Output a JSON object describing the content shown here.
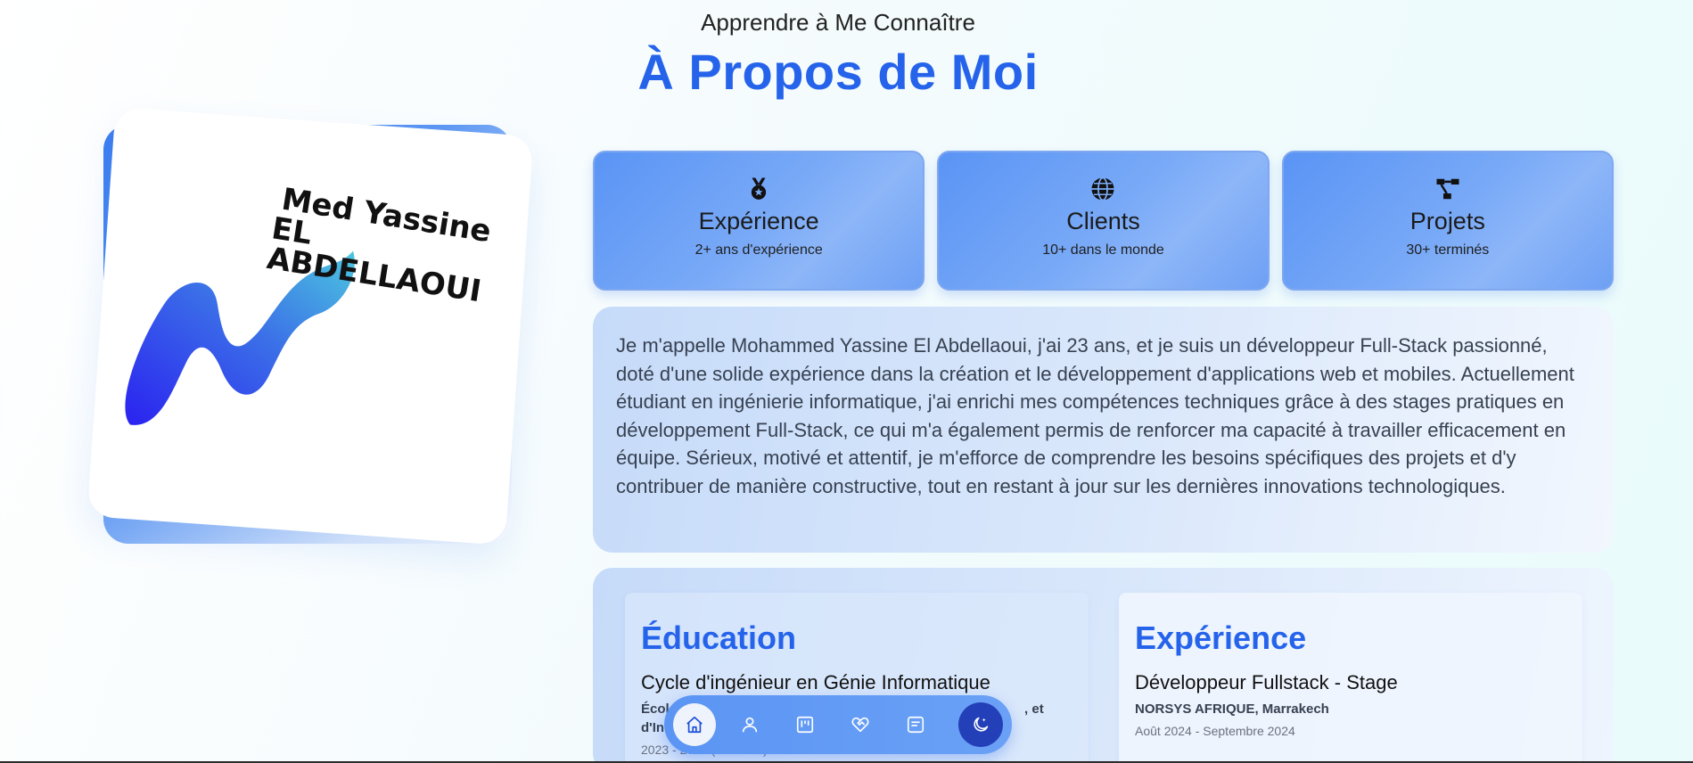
{
  "header": {
    "subtitle": "Apprendre à Me Connaître",
    "title": "À Propos de Moi"
  },
  "profile": {
    "logo_line1": "Med Yassine",
    "logo_line2": "EL ABDELLAOUI"
  },
  "stats": [
    {
      "icon": "medal-icon",
      "label": "Expérience",
      "detail": "2+ ans d'expérience"
    },
    {
      "icon": "globe-icon",
      "label": "Clients",
      "detail": "10+ dans le monde"
    },
    {
      "icon": "project-diagram-icon",
      "label": "Projets",
      "detail": "30+ terminés"
    }
  ],
  "bio": "Je m'appelle Mohammed Yassine El Abdellaoui, j'ai 23 ans, et je suis un développeur Full-Stack passionné, doté d'une solide expérience dans la création et le développement d'applications web et mobiles. Actuellement étudiant en ingénierie informatique, j'ai enrichi mes compétences techniques grâce à des stages pratiques en développement Full-Stack, ce qui m'a également permis de renforcer ma capacité à travailler efficacement en équipe. Sérieux, motivé et attentif, je m'efforce de comprendre les besoins spécifiques des projets et d'y contribuer de manière constructive, tout en restant à jour sur les dernières innovations technologiques.",
  "education": {
    "heading": "Éducation",
    "role": "Cycle d'ingénieur en Génie Informatique",
    "org_visible_start": "Écol",
    "org_visible_end": ", et",
    "org_line2_start": "d'In",
    "date": "2023 - 2025 (en cours)"
  },
  "experience": {
    "heading": "Expérience",
    "role": "Développeur Fullstack - Stage",
    "org": "NORSYS AFRIQUE, Marrakech",
    "date": "Août 2024 - Septembre 2024"
  },
  "nav": {
    "items": [
      {
        "icon": "home-icon",
        "active": true
      },
      {
        "icon": "user-icon",
        "active": false
      },
      {
        "icon": "kanban-icon",
        "active": false
      },
      {
        "icon": "heart-handshake-icon",
        "active": false
      },
      {
        "icon": "message-icon",
        "active": false
      }
    ],
    "theme_toggle_icon": "moon-stars-icon"
  },
  "colors": {
    "accent": "#2563eb",
    "card_blue": "#6ea0f4",
    "nav_dark": "#2340b8"
  }
}
